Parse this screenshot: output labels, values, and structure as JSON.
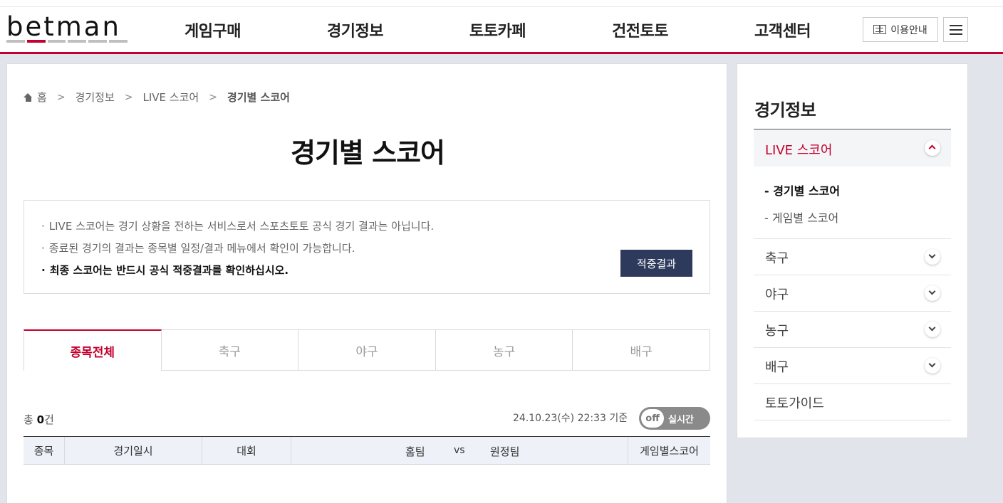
{
  "header": {
    "logo_text": "betman",
    "nav": [
      "게임구매",
      "경기정보",
      "토토카페",
      "건전토토",
      "고객센터"
    ],
    "guide_label": "이용안내"
  },
  "breadcrumb": {
    "home": "홈",
    "level1": "경기정보",
    "level2": "LIVE 스코어",
    "current": "경기별 스코어"
  },
  "page_title": "경기별 스코어",
  "notice": {
    "lines": [
      "LIVE 스코어는 경기 상황을 전하는 서비스로서 스포츠토토 공식 경기 결과는 아닙니다.",
      "종료된 경기의 결과는 종목별 일정/결과 메뉴에서 확인이 가능합니다.",
      "최종 스코어는 반드시 공식 적중결과를 확인하십시오."
    ],
    "button_label": "적중결과"
  },
  "tabs": [
    "종목전체",
    "축구",
    "야구",
    "농구",
    "배구"
  ],
  "active_tab": "종목전체",
  "summary": {
    "count_prefix": "총 ",
    "count": "0",
    "count_suffix": "건",
    "updated": "24.10.23(수) 22:33 기준",
    "toggle_off": "off",
    "toggle_label": "실시간"
  },
  "table": {
    "headers": {
      "sport": "종목",
      "datetime": "경기일시",
      "league": "대회",
      "home": "홈팀",
      "vs": "vs",
      "away": "원정팀",
      "score": "게임별스코어"
    }
  },
  "side": {
    "title": "경기정보",
    "live_label": "LIVE 스코어",
    "sub_items": [
      "- 경기별 스코어",
      "- 게임별 스코어"
    ],
    "items": [
      "축구",
      "야구",
      "농구",
      "배구",
      "토토가이드"
    ]
  },
  "colors": {
    "accent": "#c3002f",
    "button_navy": "#2e3a5c",
    "background": "#e1e4ea"
  }
}
